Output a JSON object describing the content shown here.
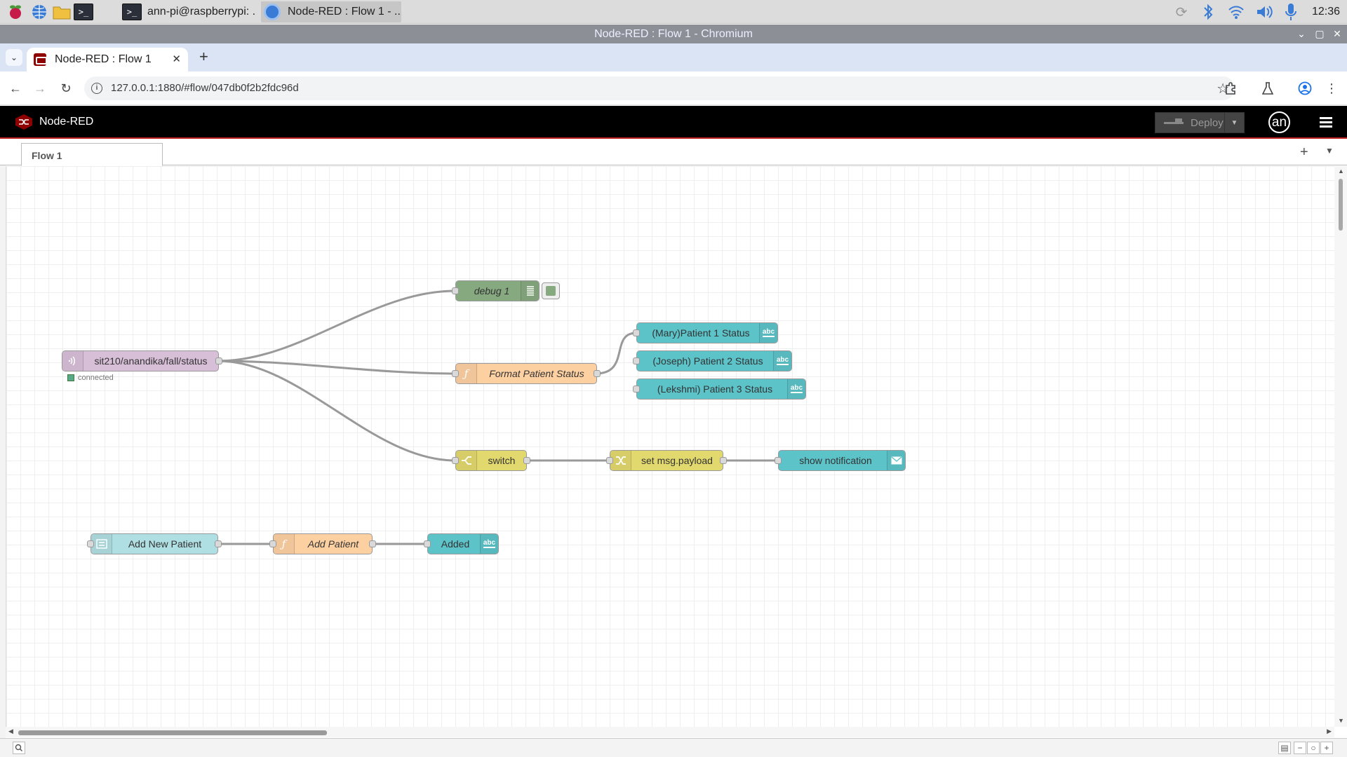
{
  "taskbar": {
    "icons": [
      "raspberry-icon",
      "globe-icon",
      "folder-icon",
      "terminal-icon"
    ],
    "tasks": [
      {
        "label": "ann-pi@raspberrypi: ."
      },
      {
        "label": "Node-RED : Flow 1 - .."
      }
    ],
    "clock": "12:36"
  },
  "browser": {
    "window_title": "Node-RED : Flow 1 - Chromium",
    "tab_title": "Node-RED : Flow 1",
    "url": "127.0.0.1:1880/#flow/047db0f2b2fdc96d"
  },
  "nodered": {
    "app_title": "Node-RED",
    "deploy_label": "Deploy",
    "user_initials": "an",
    "flow_tab": "Flow 1"
  },
  "nodes": {
    "mqtt_in": {
      "label": "sit210/anandika/fall/status",
      "status": "connected"
    },
    "debug": {
      "label": "debug 1"
    },
    "format_fn": {
      "label": "Format Patient Status"
    },
    "patient1": {
      "label": "(Mary)Patient 1 Status"
    },
    "patient2": {
      "label": "(Joseph) Patient 2 Status"
    },
    "patient3": {
      "label": "(Lekshmi) Patient 3 Status"
    },
    "switch": {
      "label": "switch"
    },
    "change": {
      "label": "set msg.payload"
    },
    "notification": {
      "label": "show notification"
    },
    "form": {
      "label": "Add New Patient"
    },
    "add_fn": {
      "label": "Add Patient"
    },
    "added": {
      "label": "Added"
    }
  },
  "colors": {
    "mqtt": "#d8bfd8",
    "debug": "#87a980",
    "function": "#fdd0a2",
    "dashboard_text": "#5cc3c9",
    "switch": "#e2d96e",
    "form": "#b0dfe3",
    "node_red_red": "#8f0000"
  },
  "status": {
    "connected_color": "#5a8"
  }
}
